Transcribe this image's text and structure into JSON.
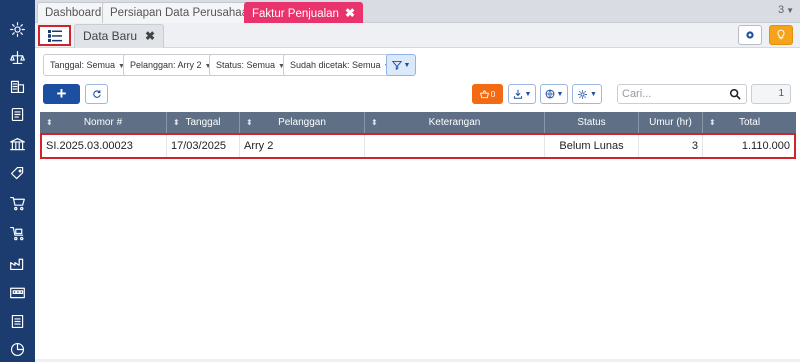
{
  "sidebar": {
    "icons": [
      "gear-icon",
      "scale-icon",
      "building-icon",
      "ledger-icon",
      "bank-icon",
      "tag-icon",
      "cart-icon",
      "cart-box-icon",
      "factory-icon",
      "warehouse-icon",
      "report-icon",
      "chart-icon"
    ]
  },
  "top_tabs": [
    {
      "label": "Dashboard",
      "active": false
    },
    {
      "label": "Persiapan Data Perusahaan",
      "active": false
    },
    {
      "label": "Faktur Penjualan",
      "active": true,
      "close": "✖"
    }
  ],
  "page_number": "3",
  "sub_tab": {
    "label": "Data Baru",
    "close": "✖"
  },
  "filters": {
    "tanggal": "Tanggal: Semua",
    "pelanggan": "Pelanggan: Arry 2",
    "status": "Status: Semua",
    "dicetak": "Sudah dicetak: Semua"
  },
  "toolbar": {
    "add_label": "+",
    "cart_count": "0",
    "search_placeholder": "Cari...",
    "page": "1"
  },
  "table": {
    "columns": [
      "Nomor #",
      "Tanggal",
      "Pelanggan",
      "Keterangan",
      "Status",
      "Umur (hr)",
      "Total"
    ],
    "rows": [
      {
        "nomor": "SI.2025.03.00023",
        "tanggal": "17/03/2025",
        "pelanggan": "Arry 2",
        "keterangan": "",
        "status": "Belum Lunas",
        "umur": "3",
        "total": "1.110.000"
      }
    ]
  },
  "colors": {
    "sidebar": "#1c3b6e",
    "active_tab": "#e8336d",
    "primary": "#1c4fa0",
    "header": "#5e6f86",
    "highlight": "#d0242b",
    "cart": "#f36a12",
    "bulb": "#f5a31a"
  }
}
